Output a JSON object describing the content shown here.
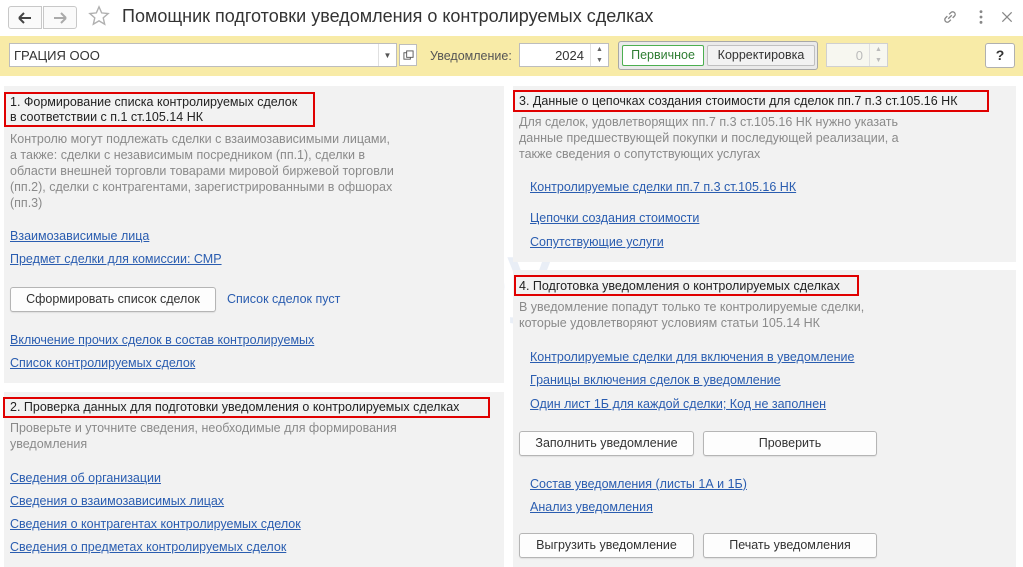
{
  "window": {
    "title": "Помощник подготовки уведомления о контролируемых сделках",
    "icons": [
      "back-arrow-icon",
      "forward-arrow-icon",
      "star-icon",
      "link-icon",
      "more-icon",
      "close-icon"
    ]
  },
  "toolbar": {
    "organization_value": "ГРАЦИЯ ООО",
    "notice_label": "Уведомление:",
    "year_value": "2024",
    "type_primary": "Первичное",
    "type_correction": "Корректировка",
    "correction_number": "0",
    "help_label": "?"
  },
  "section1": {
    "title_line1": "1. Формирование списка контролируемых сделок",
    "title_line2": "в соответствии с п.1 ст.105.14 НК",
    "desc": [
      "Контролю могут подлежать сделки с взаимозависимыми лицами,",
      "а также: сделки с независимым посредником (пп.1), сделки в",
      "области внешней торговли товарами мировой биржевой торговли",
      "(пп.2), сделки с контрагентами, зарегистрированными в офшорах",
      "(пп.3)"
    ],
    "link_related": "Взаимозависимые лица",
    "link_subject": "Предмет сделки для комиссии: СМР",
    "btn_form": "Сформировать список сделок",
    "status_list": "Список сделок пуст",
    "link_include_other": "Включение прочих сделок в состав контролируемых",
    "link_list": "Список контролируемых сделок"
  },
  "section2": {
    "title": "2. Проверка данных для подготовки уведомления о контролируемых сделках",
    "desc": [
      "Проверьте и уточните сведения, необходимые для формирования",
      "уведомления"
    ],
    "links": [
      "Сведения об организации",
      "Сведения о взаимозависимых лицах",
      "Сведения о контрагентах контролируемых сделок",
      "Сведения о предметах контролируемых сделок"
    ]
  },
  "section3": {
    "title": "3. Данные о цепочках создания стоимости для сделок пп.7 п.3 ст.105.16 НК",
    "desc": [
      "Для сделок, удовлетворящих пп.7 п.3 ст.105.16 НК нужно указать",
      "данные предшествующей покупки и последующей реализации, а",
      "также сведения о сопутствующих услугах"
    ],
    "links": [
      "Контролируемые сделки пп.7 п.3 ст.105.16 НК",
      "Цепочки создания стоимости",
      "Сопутствующие услуги"
    ]
  },
  "section4": {
    "title": "4. Подготовка уведомления о контролируемых сделках",
    "desc": [
      "В уведомление попадут только те контролируемые сделки,",
      "которые удовлетворяют условиям статьи 105.14 НК"
    ],
    "links": [
      "Контролируемые сделки для включения в уведомление",
      "Границы включения сделок в уведомление",
      "Один лист 1Б для каждой сделки; Код не заполнен"
    ],
    "btn_fill": "Заполнить уведомление",
    "btn_check": "Проверить",
    "link_composition": "Состав уведомления (листы 1А и 1Б)",
    "link_analysis": "Анализ уведомления",
    "btn_upload": "Выгрузить уведомление",
    "btn_print": "Печать уведомления"
  },
  "watermark": {
    "text": "Бу"
  }
}
